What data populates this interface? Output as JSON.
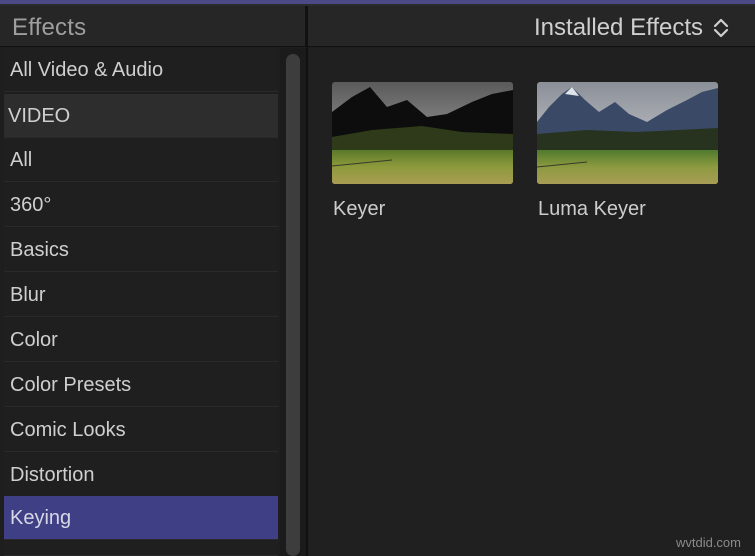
{
  "sidebar": {
    "title": "Effects",
    "items": [
      {
        "label": "All Video & Audio"
      },
      {
        "label": "VIDEO"
      },
      {
        "label": "All"
      },
      {
        "label": "360°"
      },
      {
        "label": "Basics"
      },
      {
        "label": "Blur"
      },
      {
        "label": "Color"
      },
      {
        "label": "Color Presets"
      },
      {
        "label": "Comic Looks"
      },
      {
        "label": "Distortion"
      },
      {
        "label": "Keying"
      }
    ],
    "selected": "Keying"
  },
  "browser": {
    "source_menu": "Installed Effects",
    "effects": [
      {
        "label": "Keyer"
      },
      {
        "label": "Luma Keyer"
      }
    ]
  },
  "icons": {
    "source_menu_icon": "up-down-chevron-icon"
  },
  "colors": {
    "selection": "#3f3f86",
    "accent_top": "#4b4a86",
    "background": "#1e1e1e"
  },
  "watermark": "wvtdid.com"
}
